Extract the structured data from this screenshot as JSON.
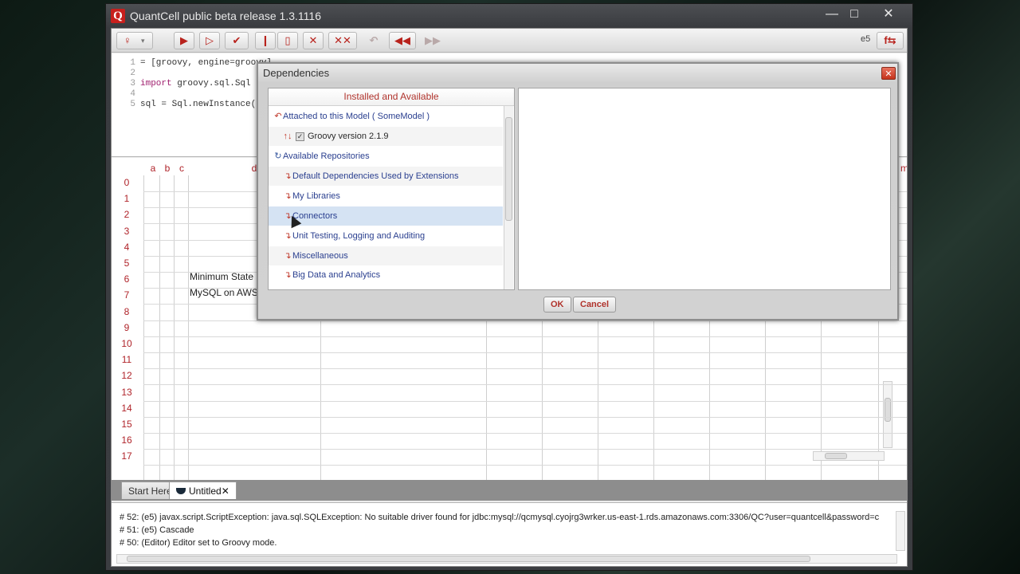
{
  "window": {
    "title": "QuantCell public beta release 1.3.1116",
    "logo_letter": "Q",
    "minimize": "—",
    "maximize": "□",
    "close": "✕"
  },
  "toolbar": {
    "user_glyph": "♀",
    "user_caret": "▾",
    "run": "▶",
    "step": "▷",
    "check": "✔",
    "pause": "❙",
    "stop": "▯",
    "cancel": "✕",
    "cancel_all": "✕✕",
    "undo": "↶",
    "rewind": "◀◀",
    "forward": "▶▶",
    "cell_ref": "e5",
    "fx": "f⇆"
  },
  "editor": {
    "lines": [
      {
        "num": "1",
        "text": "= [groovy, engine=groovy]"
      },
      {
        "num": "2",
        "text": ""
      },
      {
        "num": "3",
        "kw": "import",
        "text": " groovy.sql.Sql"
      },
      {
        "num": "4",
        "text": ""
      },
      {
        "num": "5",
        "text": "sql = Sql.newInstance("
      }
    ]
  },
  "grid": {
    "columns": [
      "a",
      "b",
      "c",
      "d"
    ],
    "right_col_fragment": "m",
    "rows": [
      "0",
      "1",
      "2",
      "3",
      "4",
      "5",
      "6",
      "7",
      "8",
      "9",
      "10",
      "11",
      "12",
      "13",
      "14",
      "15",
      "16",
      "17"
    ],
    "cells": {
      "d4": "Minimum State P",
      "d5": "MySQL on AWS ("
    }
  },
  "tabs": {
    "start": "Start Here",
    "untitled": "Untitled",
    "close": "✕"
  },
  "console": {
    "lines": [
      "# 52: (e5) javax.script.ScriptException: java.sql.SQLException: No suitable driver found for jdbc:mysql://qcmysql.cyojrg3wrker.us-east-1.rds.amazonaws.com:3306/QC?user=quantcell&password=c",
      "# 51: (e5) Cascade",
      "# 50: (Editor) Editor set to Groovy mode."
    ]
  },
  "dialog": {
    "title": "Dependencies",
    "close": "✕",
    "heading": "Installed and Available",
    "attached": {
      "glyph": "↶",
      "label": "Attached to this Model ( SomeModel )"
    },
    "groovy": {
      "arrows": "↑↓",
      "check": "✓",
      "label": "Groovy version 2.1.9"
    },
    "available": {
      "glyph": "↻",
      "label": "Available Repositories"
    },
    "repos": [
      {
        "glyph": "↴",
        "label": "Default Dependencies Used by Extensions"
      },
      {
        "glyph": "↴",
        "label": "My Libraries"
      },
      {
        "glyph": "↴",
        "label": "Connectors"
      },
      {
        "glyph": "↴",
        "label": "Unit Testing, Logging and Auditing"
      },
      {
        "glyph": "↴",
        "label": "Miscellaneous"
      },
      {
        "glyph": "↴",
        "label": "Big Data and Analytics"
      }
    ],
    "ok": "OK",
    "cancel": "Cancel"
  }
}
